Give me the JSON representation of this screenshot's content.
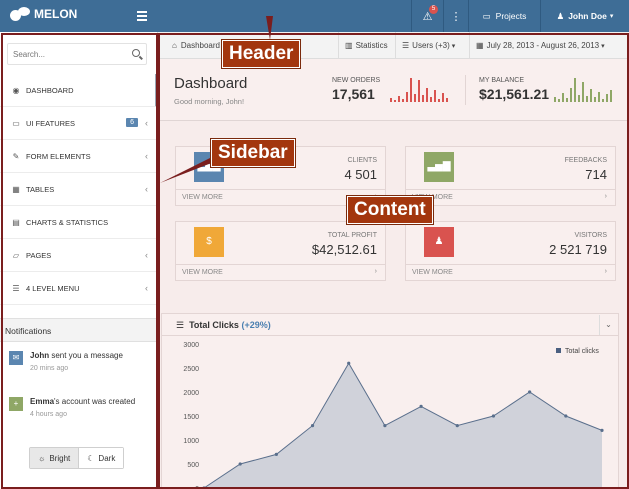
{
  "header": {
    "brand": "MELON",
    "alert_count": "5",
    "projects_label": "Projects",
    "user_name": "John Doe"
  },
  "sidebar": {
    "search_placeholder": "Search...",
    "items": [
      {
        "label": "DASHBOARD",
        "icon": "dashboard-icon"
      },
      {
        "label": "UI FEATURES",
        "icon": "desktop-icon",
        "badge": "6"
      },
      {
        "label": "FORM ELEMENTS",
        "icon": "edit-icon"
      },
      {
        "label": "TABLES",
        "icon": "table-icon"
      },
      {
        "label": "CHARTS & STATISTICS",
        "icon": "bar-chart-icon"
      },
      {
        "label": "PAGES",
        "icon": "folder-icon"
      },
      {
        "label": "4 LEVEL MENU",
        "icon": "list-icon"
      }
    ],
    "notifications": {
      "title": "Notifications",
      "items": [
        {
          "name": "John",
          "text": " sent you a message",
          "time": "20 mins ago"
        },
        {
          "name": "Emma",
          "text": "'s account was created",
          "time": "4 hours ago"
        }
      ]
    },
    "theme": {
      "bright": "Bright",
      "dark": "Dark",
      "selected": "Bright"
    }
  },
  "breadcrumb": {
    "dashboard": "Dashboard",
    "statistics": "Statistics",
    "users": "Users (+3)",
    "date_range": "July 28, 2013 - August 26, 2013"
  },
  "page_header": {
    "title": "Dashboard",
    "subtitle": "Good morning, John!",
    "new_orders_label": "NEW ORDERS",
    "new_orders_value": "17,561",
    "balance_label": "MY BALANCE",
    "balance_value": "$21,561.21",
    "spark_red": [
      4,
      2,
      6,
      3,
      10,
      24,
      8,
      22,
      7,
      14,
      5,
      12,
      3,
      9,
      4
    ],
    "spark_green": [
      5,
      3,
      9,
      4,
      14,
      24,
      7,
      20,
      6,
      13,
      5,
      10,
      3,
      8,
      12
    ]
  },
  "cards": [
    {
      "label": "CLIENTS",
      "value": "4 501",
      "footer": "VIEW MORE",
      "color": "#5b86b0"
    },
    {
      "label": "FEEDBACKS",
      "value": "714",
      "footer": "VIEW MORE",
      "color": "#8fa766"
    },
    {
      "label": "TOTAL PROFIT",
      "value": "$42,512.61",
      "footer": "VIEW MORE",
      "color": "#f0a838"
    },
    {
      "label": "VISITORS",
      "value": "2 521 719",
      "footer": "VIEW MORE",
      "color": "#d9534f"
    }
  ],
  "panel": {
    "title": "Total Clicks",
    "pct": "(+29%)"
  },
  "chart_data": {
    "type": "area",
    "x": [
      0,
      1,
      2,
      3,
      4,
      5,
      6,
      7,
      8,
      9,
      10,
      11
    ],
    "series": [
      {
        "name": "Total clicks",
        "values": [
          0,
          500,
          700,
          1300,
          2600,
          1300,
          1700,
          1300,
          1500,
          2000,
          1500,
          1200
        ]
      }
    ],
    "yticks": [
      0,
      500,
      1000,
      1500,
      2000,
      2500,
      3000
    ],
    "ylim": [
      0,
      3000
    ],
    "legend": "top-right",
    "grid": false
  },
  "annotations": {
    "header": "Header",
    "sidebar": "Sidebar",
    "content": "Content"
  },
  "colors": {
    "header": "#3e6d96",
    "annotation": "#a3360e",
    "frame": "#7a1e1e"
  }
}
